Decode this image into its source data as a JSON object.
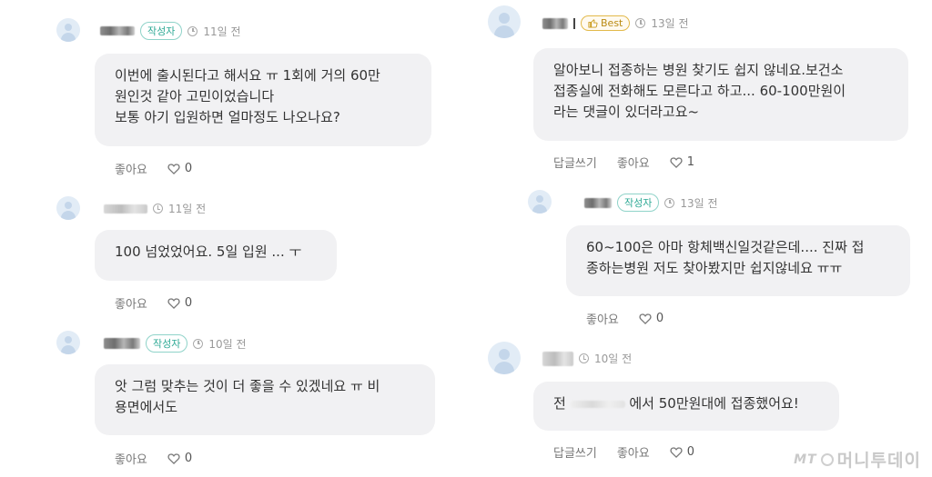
{
  "left": {
    "comments": [
      {
        "author_badge": "작성자",
        "time": "11일 전",
        "text": "이번에 출시된다고 해서요 ㅠ 1회에 거의 60만\n원인것 같아 고민이었습니다\n보통 아기 입원하면 얼마정도 나오나요?",
        "like_label": "좋아요",
        "like_count": "0"
      },
      {
        "time": "11일 전",
        "text": "100 넘었었어요. 5일 입원 ... ㅜ",
        "like_label": "좋아요",
        "like_count": "0"
      },
      {
        "author_badge": "작성자",
        "time": "10일 전",
        "text": "앗 그럼 맞추는 것이 더 좋을 수 있겠네요 ㅠ 비\n용면에서도",
        "like_label": "좋아요",
        "like_count": "0"
      }
    ]
  },
  "right": {
    "comments": [
      {
        "best_badge": "Best",
        "time": "13일 전",
        "text": "알아보니 접종하는 병원 찾기도 쉽지 않네요.보건소\n접종실에 전화해도 모른다고 하고... 60-100만원이\n라는 댓글이 있더라고요~",
        "reply_label": "답글쓰기",
        "like_label": "좋아요",
        "like_count": "1"
      },
      {
        "author_badge": "작성자",
        "time": "13일 전",
        "text": "60~100은 아마 항체백신일것같은데.... 진짜 접\n종하는병원 저도 찾아봤지만 쉽지않네요 ㅠㅠ",
        "like_label": "좋아요",
        "like_count": "0"
      },
      {
        "time": "10일 전",
        "text_prefix": "전",
        "text_suffix": "에서 50만원대에 접종했어요!",
        "reply_label": "답글쓰기",
        "like_label": "좋아요",
        "like_count": "0"
      }
    ]
  },
  "watermark": {
    "logo_mark": "MT",
    "name": "머니투데이"
  },
  "colors": {
    "bubble": "#f1f1f3",
    "author_badge": "#2ea995",
    "best_badge": "#b98a12",
    "avatar": "#e2ecf6"
  },
  "icons": {
    "time": "clock-icon",
    "like": "heart-icon",
    "best": "thumbs-up-icon",
    "avatar": "user-avatar-icon"
  }
}
